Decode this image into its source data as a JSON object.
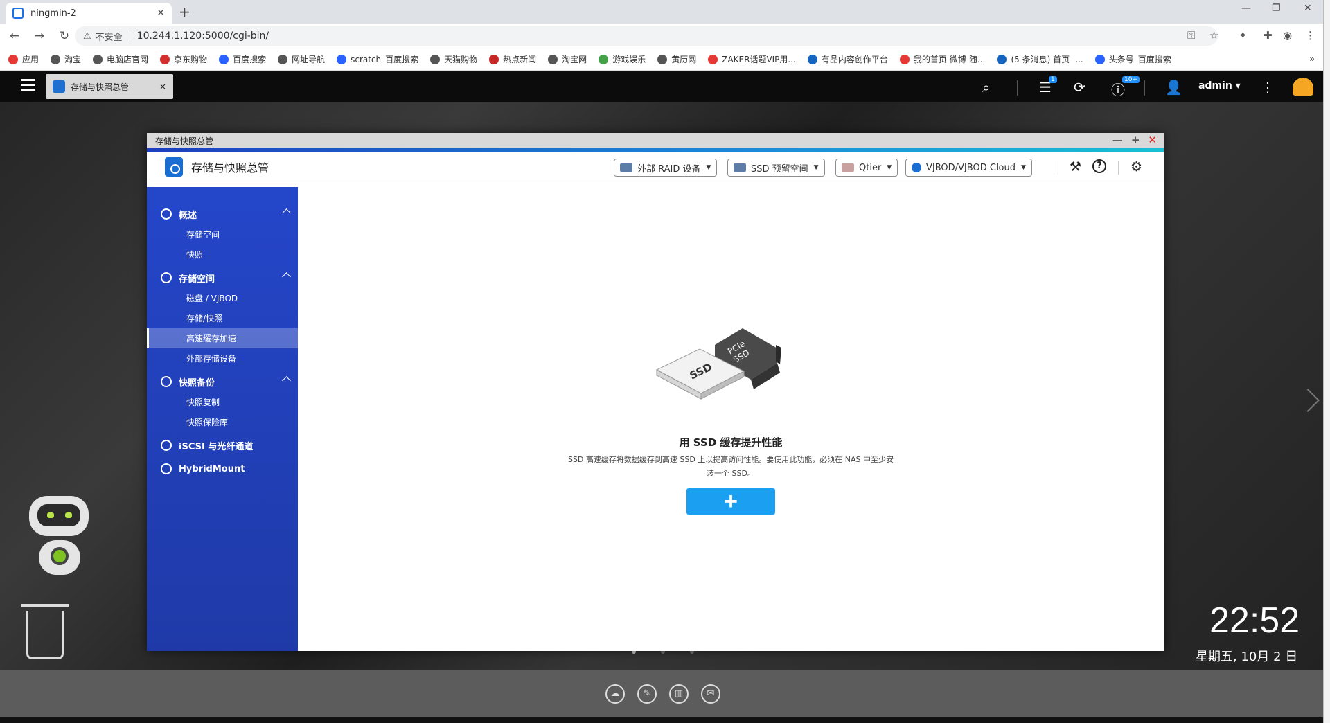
{
  "browser": {
    "tab_title": "ningmin-2",
    "new_tab": "+",
    "win_min": "—",
    "win_restore": "❐",
    "win_close": "✕",
    "back": "←",
    "forward": "→",
    "reload": "↻",
    "security_label": "不安全",
    "url": "10.244.1.120:5000/cgi-bin/",
    "key_icon": "⚿",
    "star_icon": "☆",
    "extensions_icon": "✦",
    "account_icon": "◉",
    "more_icon": "⋮",
    "bookmarks": [
      "应用",
      "淘宝",
      "电脑店官网",
      "京东购物",
      "百度搜索",
      "网址导航",
      "scratch_百度搜索",
      "天猫购物",
      "热点新闻",
      "淘宝网",
      "游戏娱乐",
      "黄历网",
      "ZAKER话题VIP用...",
      "有品内容创作平台",
      "我的首页 微博-随...",
      "(5 条消息) 首页 -...",
      "头条号_百度搜索"
    ],
    "bookmark_colors": [
      "#e53935",
      "#555",
      "#555",
      "#d32f2f",
      "#2962ff",
      "#555",
      "#2962ff",
      "#555",
      "#c62828",
      "#555",
      "#43a047",
      "#555",
      "#e53935",
      "#1565c0",
      "#e53935",
      "#1565c0",
      "#2962ff"
    ],
    "bookmarks_more": "»"
  },
  "qts": {
    "app_tab_title": "存储与快照总管",
    "app_tab_close": "×",
    "search_icon": "⌕",
    "tasks_icon": "☰",
    "tasks_badge": "1",
    "sync_icon": "⟳",
    "info_icon": "ⓘ",
    "info_badge": "10+",
    "user_icon": "👤",
    "user": "admin ▾",
    "more_icon": "⋮"
  },
  "window": {
    "title": "存储与快照总管",
    "min": "—",
    "max": "+",
    "close": "✕",
    "app_name": "存储与快照总管",
    "header_buttons": [
      {
        "label": "外部 RAID 设备"
      },
      {
        "label": "SSD 预留空间"
      },
      {
        "label": "Qtier"
      },
      {
        "label": "VJBOD/VJBOD Cloud"
      }
    ],
    "caret": "▼",
    "tools_icon": "⚒",
    "help_icon": "?",
    "settings_icon": "⚙"
  },
  "sidebar": {
    "groups": [
      {
        "label": "概述",
        "items": [
          "存储空间",
          "快照"
        ]
      },
      {
        "label": "存储空间",
        "items": [
          "磁盘 / VJBOD",
          "存储/快照",
          "高速缓存加速",
          "外部存储设备"
        ]
      },
      {
        "label": "快照备份",
        "items": [
          "快照复制",
          "快照保险库"
        ]
      },
      {
        "label": "iSCSI 与光纤通道",
        "items": []
      },
      {
        "label": "HybridMount",
        "items": []
      }
    ],
    "active": "高速缓存加速"
  },
  "main": {
    "illus_ssd": "SSD",
    "illus_pcie": "PCIe",
    "illus_pcie2": "SSD",
    "title": "用 SSD 缓存提升性能",
    "description": "SSD 高速缓存将数据缓存到高速 SSD 上以提高访问性能。要使用此功能，必须在 NAS 中至少安装一个 SSD。",
    "add_label": "+"
  },
  "desktop": {
    "time": "22:52",
    "date": "星期五, 10月 2 日",
    "dock": [
      "☁",
      "✎",
      "▥",
      "✉"
    ]
  }
}
